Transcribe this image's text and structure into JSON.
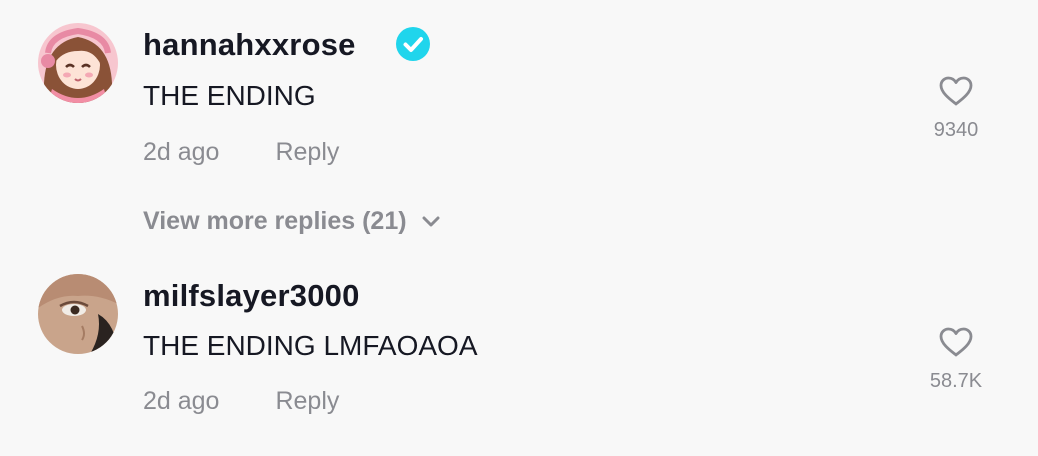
{
  "comments": [
    {
      "username": "hannahxxrose",
      "verified": true,
      "text": "THE ENDING",
      "time": "2d ago",
      "reply_label": "Reply",
      "likes": "9340",
      "avatar_icon": "cartoon-girl-avatar"
    },
    {
      "username": "milfslayer3000",
      "verified": false,
      "text": "THE ENDING LMFAOAOA",
      "time": "2d ago",
      "reply_label": "Reply",
      "likes": "58.7K",
      "avatar_icon": "face-closeup-avatar"
    }
  ],
  "view_more_replies": "View more replies (21)",
  "colors": {
    "background": "#f8f8f8",
    "primary_text": "#161823",
    "secondary_text": "#8a8b91",
    "verified_badge": "#20d5ec"
  }
}
